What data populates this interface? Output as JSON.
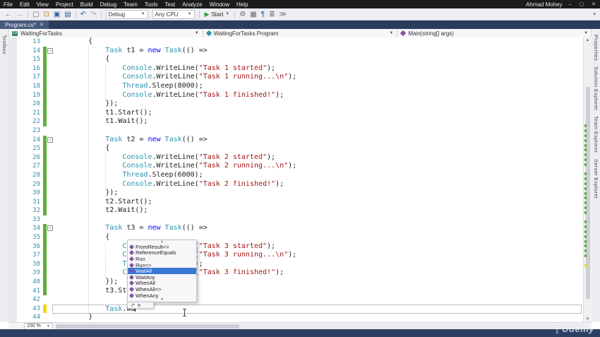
{
  "window": {
    "user": "Ahmad Mohey",
    "menu": [
      "File",
      "Edit",
      "View",
      "Project",
      "Build",
      "Debug",
      "Team",
      "Tools",
      "Test",
      "Analyze",
      "Window",
      "Help"
    ],
    "controls": {
      "minimize": "–",
      "maximize": "▢",
      "close": "✕"
    }
  },
  "toolbar": {
    "config": "Debug",
    "platform": "Any CPU",
    "start_label": "Start",
    "overflow": "▾",
    "items": [
      {
        "ty": "icon",
        "name": "nav-back-icon",
        "g": "←",
        "c": "#3b6bbf"
      },
      {
        "ty": "icon",
        "name": "nav-forward-icon",
        "g": "→",
        "c": "#9aa0a6"
      },
      {
        "ty": "sep"
      },
      {
        "ty": "icon",
        "name": "new-file-icon",
        "g": "▢",
        "c": "#6a6a6a"
      },
      {
        "ty": "icon",
        "name": "open-file-icon",
        "g": "⊡",
        "c": "#b58a3c"
      },
      {
        "ty": "icon",
        "name": "save-icon",
        "g": "▣",
        "c": "#2a61a8"
      },
      {
        "ty": "icon",
        "name": "save-all-icon",
        "g": "▤",
        "c": "#2a61a8"
      },
      {
        "ty": "sep"
      },
      {
        "ty": "icon",
        "name": "undo-icon",
        "g": "↶",
        "c": "#2a61a8"
      },
      {
        "ty": "icon",
        "name": "redo-icon",
        "g": "↷",
        "c": "#9aa0a6"
      },
      {
        "ty": "sep"
      },
      {
        "ty": "combo",
        "name": "solution-config-dropdown",
        "bind": "config"
      },
      {
        "ty": "combo",
        "name": "platform-dropdown",
        "bind": "platform"
      },
      {
        "ty": "sep"
      },
      {
        "ty": "start"
      },
      {
        "ty": "sep"
      },
      {
        "ty": "icon",
        "name": "build-icon",
        "g": "⚙",
        "c": "#6a6a6a"
      },
      {
        "ty": "icon",
        "name": "show-threads-icon",
        "g": "▦",
        "c": "#6a6a6a"
      },
      {
        "ty": "icon",
        "name": "comment-icon",
        "g": "¶",
        "c": "#2a61a8"
      },
      {
        "ty": "icon",
        "name": "line-display-icon",
        "g": "≣",
        "c": "#6a6a6a"
      },
      {
        "ty": "icon",
        "name": "find-icon",
        "g": "≫",
        "c": "#6a6a6a"
      }
    ]
  },
  "tabs": {
    "active": "Program.cs*",
    "close": "✕"
  },
  "navbar": {
    "project": "WaitingForTasks",
    "type": "WaitingForTasks.Program",
    "member": "Main(string[] args)",
    "project_badge": "C#"
  },
  "side_tabs": {
    "left": [
      "Toolbox"
    ],
    "right": [
      "Properties",
      "Solution Explorer",
      "Team Explorer",
      "Server Explorer"
    ]
  },
  "editor": {
    "zoom_label": "150 %",
    "lines": [
      {
        "n": 13,
        "i": 8,
        "m": null,
        "t": [
          [
            "p",
            "{"
          ]
        ]
      },
      {
        "n": 14,
        "i": 12,
        "m": "g",
        "fold": true,
        "t": [
          [
            "y",
            "Task"
          ],
          [
            "p",
            " t1 = "
          ],
          [
            "k",
            "new"
          ],
          [
            "p",
            " "
          ],
          [
            "y",
            "Task"
          ],
          [
            "p",
            "(() =>"
          ]
        ]
      },
      {
        "n": 15,
        "i": 12,
        "m": "g",
        "t": [
          [
            "p",
            "{"
          ]
        ]
      },
      {
        "n": 16,
        "i": 16,
        "m": "g",
        "t": [
          [
            "y",
            "Console"
          ],
          [
            "p",
            ".WriteLine("
          ],
          [
            "s",
            "\"Task 1 started\""
          ],
          [
            "p",
            ");"
          ]
        ]
      },
      {
        "n": 17,
        "i": 16,
        "m": "g",
        "t": [
          [
            "y",
            "Console"
          ],
          [
            "p",
            ".WriteLine("
          ],
          [
            "s",
            "\"Task 1 running...\\n\""
          ],
          [
            "p",
            ");"
          ]
        ]
      },
      {
        "n": 18,
        "i": 16,
        "m": "g",
        "t": [
          [
            "y",
            "Thread"
          ],
          [
            "p",
            ".Sleep(8000);"
          ]
        ]
      },
      {
        "n": 19,
        "i": 16,
        "m": "g",
        "t": [
          [
            "y",
            "Console"
          ],
          [
            "p",
            ".WriteLine("
          ],
          [
            "s",
            "\"Task 1 finished!\""
          ],
          [
            "p",
            ");"
          ]
        ]
      },
      {
        "n": 20,
        "i": 12,
        "m": "g",
        "t": [
          [
            "p",
            "});"
          ]
        ]
      },
      {
        "n": 21,
        "i": 12,
        "m": "g",
        "t": [
          [
            "p",
            "t1.Start();"
          ]
        ]
      },
      {
        "n": 22,
        "i": 12,
        "m": "g",
        "t": [
          [
            "p",
            "t1.Wait();"
          ]
        ]
      },
      {
        "n": 23,
        "i": 0,
        "m": null,
        "t": []
      },
      {
        "n": 24,
        "i": 12,
        "m": "g",
        "fold": true,
        "t": [
          [
            "y",
            "Task"
          ],
          [
            "p",
            " t2 = "
          ],
          [
            "k",
            "new"
          ],
          [
            "p",
            " "
          ],
          [
            "y",
            "Task"
          ],
          [
            "p",
            "(() =>"
          ]
        ]
      },
      {
        "n": 25,
        "i": 12,
        "m": "g",
        "t": [
          [
            "p",
            "{"
          ]
        ]
      },
      {
        "n": 26,
        "i": 16,
        "m": "g",
        "t": [
          [
            "y",
            "Console"
          ],
          [
            "p",
            ".WriteLine("
          ],
          [
            "s",
            "\"Task 2 started\""
          ],
          [
            "p",
            ");"
          ]
        ]
      },
      {
        "n": 27,
        "i": 16,
        "m": "g",
        "t": [
          [
            "y",
            "Console"
          ],
          [
            "p",
            ".WriteLine("
          ],
          [
            "s",
            "\"Task 2 running...\\n\""
          ],
          [
            "p",
            ");"
          ]
        ]
      },
      {
        "n": 28,
        "i": 16,
        "m": "g",
        "t": [
          [
            "y",
            "Thread"
          ],
          [
            "p",
            ".Sleep(6000);"
          ]
        ]
      },
      {
        "n": 29,
        "i": 16,
        "m": "g",
        "t": [
          [
            "y",
            "Console"
          ],
          [
            "p",
            ".WriteLine("
          ],
          [
            "s",
            "\"Task 2 finished!\""
          ],
          [
            "p",
            ");"
          ]
        ]
      },
      {
        "n": 30,
        "i": 12,
        "m": "g",
        "t": [
          [
            "p",
            "});"
          ]
        ]
      },
      {
        "n": 31,
        "i": 12,
        "m": "g",
        "t": [
          [
            "p",
            "t2.Start();"
          ]
        ]
      },
      {
        "n": 32,
        "i": 12,
        "m": "g",
        "t": [
          [
            "p",
            "t2.Wait();"
          ]
        ]
      },
      {
        "n": 33,
        "i": 0,
        "m": null,
        "t": []
      },
      {
        "n": 34,
        "i": 12,
        "m": "g",
        "fold": true,
        "t": [
          [
            "y",
            "Task"
          ],
          [
            "p",
            " t3 = "
          ],
          [
            "k",
            "new"
          ],
          [
            "p",
            " "
          ],
          [
            "y",
            "Task"
          ],
          [
            "p",
            "(() =>"
          ]
        ]
      },
      {
        "n": 35,
        "i": 12,
        "m": "g",
        "t": [
          [
            "p",
            "{"
          ]
        ]
      },
      {
        "n": 36,
        "i": 16,
        "m": "g",
        "t": [
          [
            "y",
            "Console"
          ],
          [
            "p",
            ".WriteLine("
          ],
          [
            "s",
            "\"Task 3 started\""
          ],
          [
            "p",
            ");"
          ]
        ]
      },
      {
        "n": 37,
        "i": 16,
        "m": "g",
        "t": [
          [
            "y",
            "Console"
          ],
          [
            "p",
            ".WriteLine("
          ],
          [
            "s",
            "\"Task 3 running...\\n\""
          ],
          [
            "p",
            ");"
          ]
        ]
      },
      {
        "n": 38,
        "i": 16,
        "m": "g",
        "t": [
          [
            "y",
            "Thread"
          ],
          [
            "p",
            ".Sleep(4000);"
          ]
        ]
      },
      {
        "n": 39,
        "i": 16,
        "m": "g",
        "t": [
          [
            "y",
            "Console"
          ],
          [
            "p",
            ".WriteLine("
          ],
          [
            "s",
            "\"Task 3 finished!\""
          ],
          [
            "p",
            ");"
          ]
        ]
      },
      {
        "n": 40,
        "i": 12,
        "m": "g",
        "t": [
          [
            "p",
            "});"
          ]
        ]
      },
      {
        "n": 41,
        "i": 12,
        "m": "g",
        "t": [
          [
            "p",
            "t3.Start();"
          ]
        ]
      },
      {
        "n": 42,
        "i": 0,
        "m": null,
        "t": []
      },
      {
        "n": 43,
        "i": 12,
        "m": "y",
        "caret": true,
        "t": [
          [
            "y",
            "Task"
          ],
          [
            "p",
            ".wa"
          ]
        ]
      },
      {
        "n": 44,
        "i": 8,
        "m": null,
        "t": [
          [
            "p",
            "}"
          ]
        ]
      }
    ]
  },
  "intellisense": {
    "items": [
      "FromResult<>",
      "ReferenceEquals",
      "Run",
      "Run<>",
      "WaitAll",
      "WaitAny",
      "WhenAll",
      "WhenAll<>",
      "WhenAny"
    ],
    "selected_index": 4,
    "scroll_up": "▲",
    "scroll_down": "▼"
  },
  "watermark": {
    "text": "Udemy"
  },
  "colors": {
    "keyword": "#0000ff",
    "type": "#2b91af",
    "string": "#a31515",
    "selection": "#3978d4",
    "change_saved": "#5fae3c",
    "change_unsaved": "#f2d816"
  }
}
